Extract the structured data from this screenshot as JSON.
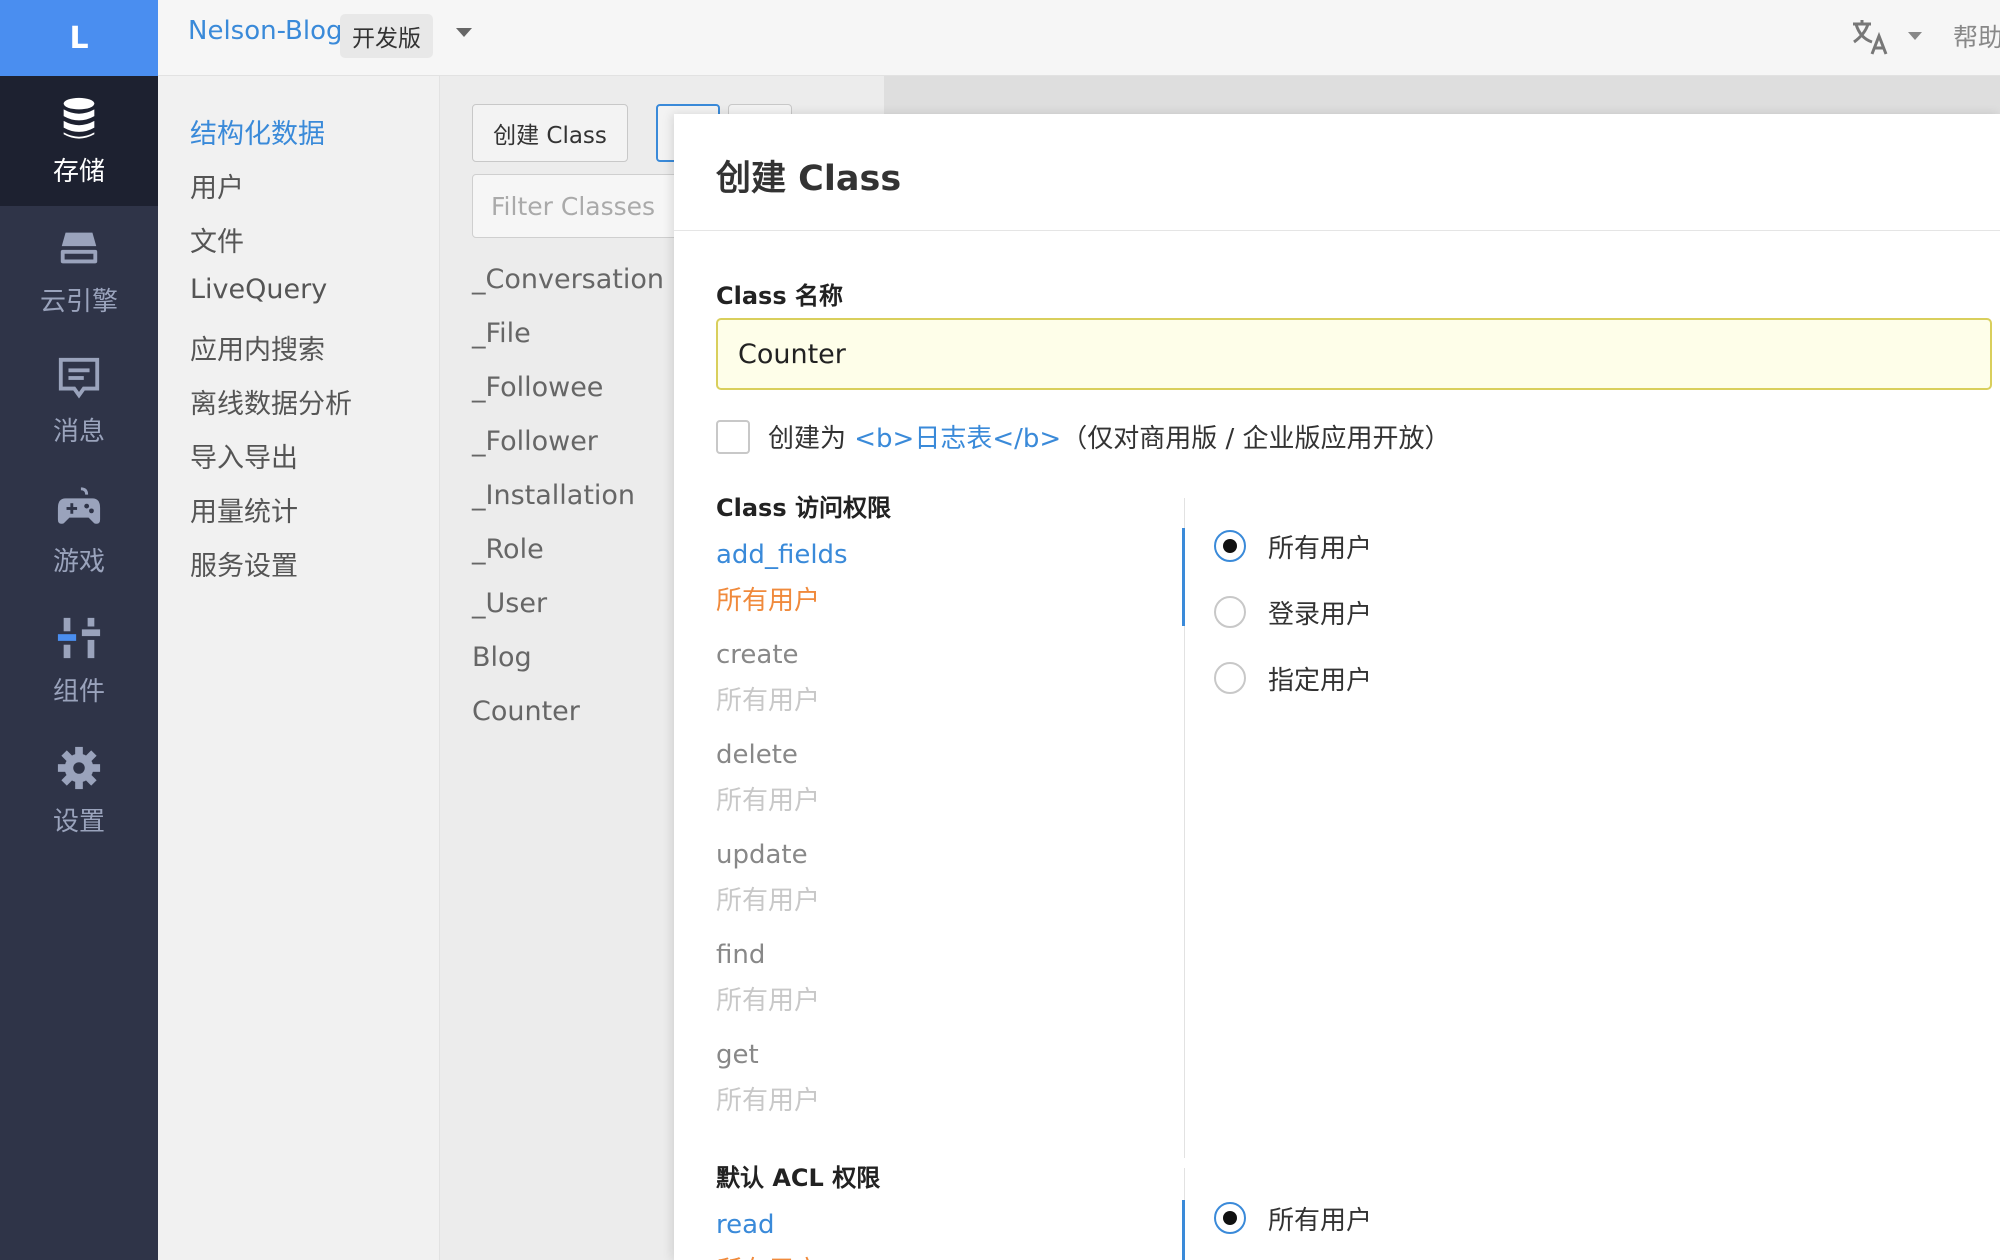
{
  "nav": {
    "logo": "L",
    "items": [
      {
        "label": "存储",
        "icon": "database-icon",
        "active": true
      },
      {
        "label": "云引擎",
        "icon": "server-icon",
        "active": false
      },
      {
        "label": "消息",
        "icon": "message-icon",
        "active": false
      },
      {
        "label": "游戏",
        "icon": "gamepad-icon",
        "active": false
      },
      {
        "label": "组件",
        "icon": "sliders-icon",
        "active": false
      },
      {
        "label": "设置",
        "icon": "gear-icon",
        "active": false
      }
    ]
  },
  "topbar": {
    "app_name": "Nelson-Blog",
    "env": "开发版",
    "help": "帮助"
  },
  "submenu": {
    "items": [
      "结构化数据",
      "用户",
      "文件",
      "LiveQuery",
      "应用内搜索",
      "离线数据分析",
      "导入导出",
      "用量统计",
      "服务设置"
    ]
  },
  "classpanel": {
    "create_label": "创建 Class",
    "filter_placeholder": "Filter Classes",
    "classes": [
      "_Conversation",
      "_File",
      "_Followee",
      "_Follower",
      "_Installation",
      "_Role",
      "_User",
      "Blog",
      "Counter"
    ]
  },
  "modal": {
    "title": "创建 Class",
    "name_label": "Class 名称",
    "name_value": "Counter",
    "checkbox_prefix": "创建为 ",
    "checkbox_link": "<b>日志表</b>",
    "checkbox_suffix": "（仅对商用版 / 企业版应用开放）",
    "access_label": "Class 访问权限",
    "permissions": [
      {
        "name": "add_fields",
        "value": "所有用户"
      },
      {
        "name": "create",
        "value": "所有用户"
      },
      {
        "name": "delete",
        "value": "所有用户"
      },
      {
        "name": "update",
        "value": "所有用户"
      },
      {
        "name": "find",
        "value": "所有用户"
      },
      {
        "name": "get",
        "value": "所有用户"
      }
    ],
    "radio_options": [
      "所有用户",
      "登录用户",
      "指定用户"
    ],
    "acl_label": "默认 ACL 权限",
    "acl_read_name": "read",
    "acl_read_value": "所有用户",
    "acl_radio_first": "所有用户"
  },
  "colors": {
    "nav_bg": "#2f3448",
    "accent": "#3a8ad9",
    "logo_bg": "#4a8ef0",
    "orange": "#f08a3c"
  }
}
